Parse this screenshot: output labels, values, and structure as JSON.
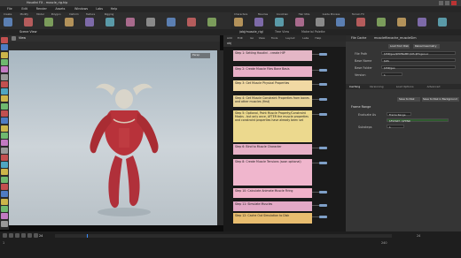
{
  "titlebar": {
    "text": "Houdini FX - muscle_rig.hip"
  },
  "menus": [
    "File",
    "Edit",
    "Render",
    "Assets",
    "Windows",
    "Labs",
    "Help"
  ],
  "shelf_tabs": [
    "Create",
    "Modify",
    "Model",
    "Polygon",
    "Deform",
    "Texture",
    "Rigging",
    "Characters",
    "Muscles",
    "Constrain",
    "Hair Utils",
    "Guide Process",
    "Terrain FX"
  ],
  "viewport": {
    "tab": "Scene View",
    "label": "View",
    "camera": "Persp",
    "cam_label": "No cam"
  },
  "network": {
    "path": "obj",
    "tabs": [
      "/obj/muscle_rig/",
      "Tree View",
      "Material Palette"
    ],
    "menu": [
      "Add",
      "Edit",
      "Go",
      "View",
      "Tools",
      "Layout",
      "Labs",
      "Help"
    ],
    "stickies": [
      {
        "text": "Step 1: Setting Houdini - create HIP",
        "color": "#e4b6c6"
      },
      {
        "text": "Step 2: Create Muscle Files Bone Basis",
        "color": "#e9b0c8"
      },
      {
        "text": "Step 3: Get Muscle Physical Properties",
        "color": "#f1d9a3"
      },
      {
        "text": "Step 4: Get Muscle Constraint Properties from bones and other muscles (first)",
        "color": "#e8d49b"
      },
      {
        "text": "Step 5: Optional, Paint Muscle Property/Constraint Masks - but only once, AFTER the muscle properties and constraint properties have already been set",
        "color": "#ecd98e"
      },
      {
        "text": "Step 6: Bind to Muscle Character",
        "color": "#e7b1c7"
      },
      {
        "text": "Step 8: Create Muscle Tensions (soon optional)",
        "color": "#f0b6cd"
      },
      {
        "text": "Step 10: Calculate Animate Muscle Firing",
        "color": "#f0b2c9"
      },
      {
        "text": "Step 11: Simulate Muscles",
        "color": "#e3a9c6"
      },
      {
        "text": "Step 12: Cache Out Simulation to Disk",
        "color": "#e8bd6f"
      }
    ]
  },
  "params": {
    "tab": "File Cache",
    "node": "musclefilecache_muscleSim",
    "buttons": [
      "Load from Disk",
      "Reload Geometry"
    ],
    "fields": [
      {
        "label": "File Path",
        "value": "$HIP/geo/$HIPNAME.$OS.$F.bgeo.sc"
      },
      {
        "label": "Base Name",
        "value": "$OS"
      },
      {
        "label": "Base Folder",
        "value": "$HIP/geo"
      },
      {
        "label": "Version",
        "value": "1"
      }
    ],
    "subtabs": [
      "Caching",
      "Versioning",
      "Load Options",
      "Advanced"
    ],
    "section": "Frame Range",
    "range_label": "Evaluate As",
    "range_value": "Frame Range",
    "start_end": "$FSTART / $FEND",
    "substeps_label": "Substeps",
    "substeps_value": "1",
    "save_buttons": [
      "Save to Disk",
      "Save to Disk in Background"
    ]
  },
  "timeline": {
    "frame": "24",
    "start": "1",
    "end": "240",
    "fps": "24"
  }
}
